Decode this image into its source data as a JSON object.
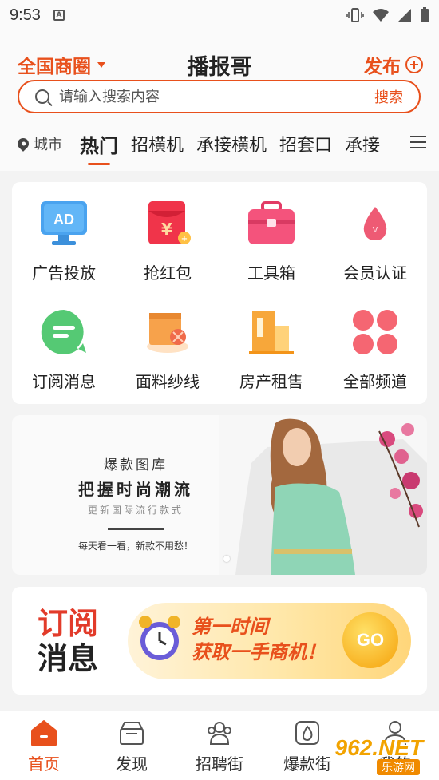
{
  "status": {
    "time": "9:53",
    "notify_glyph": "A"
  },
  "header": {
    "region": "全国商圈",
    "title": "播报哥",
    "publish": "发布"
  },
  "search": {
    "placeholder": "请输入搜索内容",
    "button": "搜索"
  },
  "categories": {
    "city": "城市",
    "tabs": [
      "热门",
      "招横机",
      "承接横机",
      "招套口",
      "承接"
    ],
    "active_index": 0
  },
  "grid": [
    {
      "label": "广告投放",
      "icon": "ad-monitor-icon"
    },
    {
      "label": "抢红包",
      "icon": "red-envelope-icon"
    },
    {
      "label": "工具箱",
      "icon": "toolbox-icon"
    },
    {
      "label": "会员认证",
      "icon": "vip-drop-icon"
    },
    {
      "label": "订阅消息",
      "icon": "chat-bubble-icon"
    },
    {
      "label": "面料纱线",
      "icon": "fabric-roll-icon"
    },
    {
      "label": "房产租售",
      "icon": "building-icon"
    },
    {
      "label": "全部频道",
      "icon": "four-petal-icon"
    }
  ],
  "banner": {
    "subtitle": "爆款图库",
    "title": "把握时尚潮流",
    "desc": "更新国际流行款式",
    "note": "每天看一看，新款不用愁！"
  },
  "subscribe": {
    "line1": "订阅",
    "line2": "消息",
    "ad_line1": "第一时间",
    "ad_line2": "获取一手商机！",
    "go": "GO"
  },
  "nav": [
    {
      "label": "首页",
      "icon": "home-icon",
      "active": true
    },
    {
      "label": "发现",
      "icon": "discover-icon",
      "active": false
    },
    {
      "label": "招聘街",
      "icon": "recruit-icon",
      "active": false
    },
    {
      "label": "爆款街",
      "icon": "hot-icon",
      "active": false
    },
    {
      "label": "我的",
      "icon": "profile-icon",
      "active": false
    }
  ],
  "watermark": {
    "text": "962.NET",
    "sub": "乐游网"
  },
  "colors": {
    "accent": "#e8501c",
    "background": "#f3f3f3"
  }
}
